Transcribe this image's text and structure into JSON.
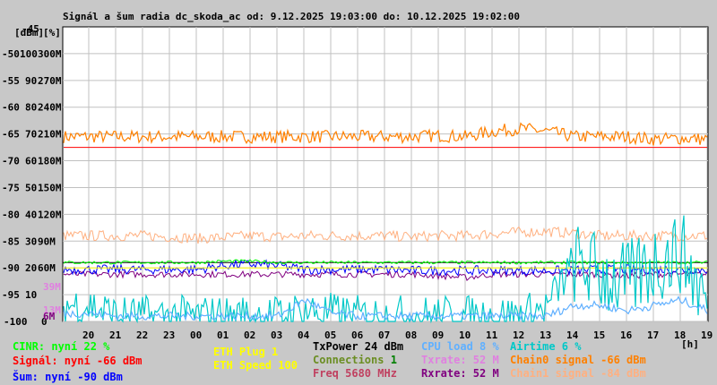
{
  "chart_data": {
    "type": "line",
    "title": "Signál a šum radia dc_skoda_ac od: 9.12.2025 19:03:00 do: 10.12.2025 19:02:00",
    "axis_units": [
      "[dBm]",
      "[%]"
    ],
    "xlabel": "[h]",
    "x_ticks": [
      "20",
      "21",
      "22",
      "23",
      "00",
      "01",
      "02",
      "03",
      "04",
      "05",
      "06",
      "07",
      "08",
      "09",
      "10",
      "11",
      "12",
      "13",
      "14",
      "15",
      "16",
      "17",
      "18",
      "19"
    ],
    "y_ticks_dbm": [
      "-45",
      "-50",
      "-55",
      "-60",
      "-65",
      "-70",
      "-75",
      "-80",
      "-85",
      "-90",
      "-95",
      "-100"
    ],
    "y_ticks_pct": [
      "100",
      "90",
      "80",
      "70",
      "60",
      "50",
      "40",
      "30",
      "20",
      "10",
      "0"
    ],
    "y_ticks_rate": [
      "300M",
      "270M",
      "240M",
      "210M",
      "180M",
      "150M",
      "120M",
      "90M",
      "60M"
    ],
    "inner_labels": [
      {
        "text": "39M",
        "color": "#e080e0",
        "value_dbm": -93.5
      },
      {
        "text": "13M",
        "color": "#e080e0",
        "value_dbm": -97.8
      },
      {
        "text": "6M",
        "color": "#800080",
        "value_dbm": -99
      }
    ],
    "ylim_dbm": [
      -100,
      -45
    ],
    "grid": true,
    "series": [
      {
        "name": "Chain0 signal",
        "unit": "dBm",
        "color": "#ff8000",
        "noise": 1.2,
        "values": [
          -65.5,
          -65.5,
          -65.5,
          -65.5,
          -65.5,
          -65.5,
          -65.5,
          -65.5,
          -65.5,
          -65.5,
          -65.5,
          -65.5,
          -65.5,
          -65.5,
          -65.3,
          -65.5,
          -64.5,
          -64,
          -64.5,
          -65.5,
          -65.5,
          -65.5,
          -66,
          -65.8,
          -66
        ]
      },
      {
        "name": "Chain1 signal",
        "unit": "dBm",
        "color": "#ffb080",
        "noise": 1.0,
        "values": [
          -84,
          -84,
          -84,
          -84,
          -84.2,
          -84.5,
          -84.3,
          -84,
          -84.2,
          -84,
          -84,
          -84,
          -84,
          -84.2,
          -84,
          -84,
          -83.6,
          -83.3,
          -83.2,
          -83.5,
          -84,
          -84,
          -84,
          -84,
          -84
        ]
      },
      {
        "name": "Signál",
        "unit": "dBm",
        "color": "#ff0000",
        "noise": 0,
        "values": [
          -67.5,
          -67.5,
          -67.5,
          -67.5,
          -67.5,
          -67.5,
          -67.5,
          -67.5,
          -67.5,
          -67.5,
          -67.5,
          -67.5,
          -67.5,
          -67.5,
          -67.5,
          -67.5,
          -67.5,
          -67.5,
          -67.5,
          -67.5,
          -67.5,
          -67.5,
          -67.5,
          -67.5,
          -67.5
        ]
      },
      {
        "name": "Rxrate",
        "unit": "dBm",
        "color": "#800080",
        "noise": 0.6,
        "values": [
          -91.2,
          -91.2,
          -91.2,
          -91.2,
          -91.2,
          -91.2,
          -91.2,
          -91.2,
          -91.2,
          -91.2,
          -91.2,
          -91.2,
          -91.2,
          -91.2,
          -91.5,
          -91.8,
          -91.2,
          -91.2,
          -91.2,
          -91.2,
          -91.2,
          -91.5,
          -91.2,
          -91.2,
          -91.2
        ]
      },
      {
        "name": "Šum",
        "unit": "dBm",
        "color": "#0000ff",
        "noise": 0.9,
        "values": [
          -90.3,
          -90.3,
          -90.3,
          -90.3,
          -90.3,
          -90.3,
          -89.5,
          -89.3,
          -89.6,
          -90.3,
          -90.3,
          -90.3,
          -90.3,
          -90.5,
          -90.5,
          -90.5,
          -90.5,
          -90.5,
          -90.5,
          -90.5,
          -90.3,
          -90.3,
          -90.3,
          -90.3,
          -90.3
        ]
      },
      {
        "name": "CINR",
        "unit": "%",
        "color": "#00ff00",
        "noise": 0.3,
        "values": [
          22,
          22,
          22,
          22,
          22,
          22,
          22.5,
          22.5,
          22,
          22,
          22,
          22,
          22,
          22,
          22,
          22,
          22,
          22,
          22,
          22,
          22,
          22,
          22,
          22,
          22
        ]
      },
      {
        "name": "ETH Plug",
        "unit": "%",
        "color": "#ffff00",
        "noise": 0,
        "values": [
          20,
          20,
          20,
          20,
          20,
          20,
          20,
          20,
          20,
          20,
          20,
          20,
          20,
          20,
          20,
          20,
          20,
          20,
          20,
          20,
          20,
          20,
          20,
          20,
          20
        ]
      },
      {
        "name": "Airtime",
        "unit": "%",
        "color": "#00c8c8",
        "noise": 8,
        "values": [
          6,
          6,
          2,
          2,
          2,
          2,
          2,
          2,
          2,
          4,
          3,
          2,
          2,
          2,
          2,
          2,
          2,
          2,
          5,
          22,
          18,
          14,
          22,
          26,
          6
        ]
      },
      {
        "name": "CPU load",
        "unit": "%",
        "color": "#60b0ff",
        "noise": 1.5,
        "values": [
          3,
          3,
          2,
          2,
          2,
          2,
          2,
          2,
          2,
          8,
          3,
          2,
          2,
          2,
          2,
          2,
          2,
          2,
          2,
          6,
          6,
          4,
          6,
          8,
          4
        ]
      }
    ]
  },
  "legend": {
    "cinr": "CINR: nyní 22 %",
    "signal": "Signál: nyní -66 dBm",
    "noise": "Šum: nyní -90 dBm",
    "eth_plug": "ETH Plug 1",
    "eth_speed": "ETH Speed 100",
    "txpower": "TxPower 24 dBm",
    "connections_label": "Connections",
    "connections_value": "1",
    "freq": "Freq 5680 MHz",
    "cpu": "CPU load 8 %",
    "txrate": "Txrate: 52 M",
    "rxrate": "Rxrate: 52 M",
    "airtime": "Airtime 6 %",
    "chain0": "Chain0 signal -66 dBm",
    "chain1": "Chain1 signal -84 dBm"
  }
}
